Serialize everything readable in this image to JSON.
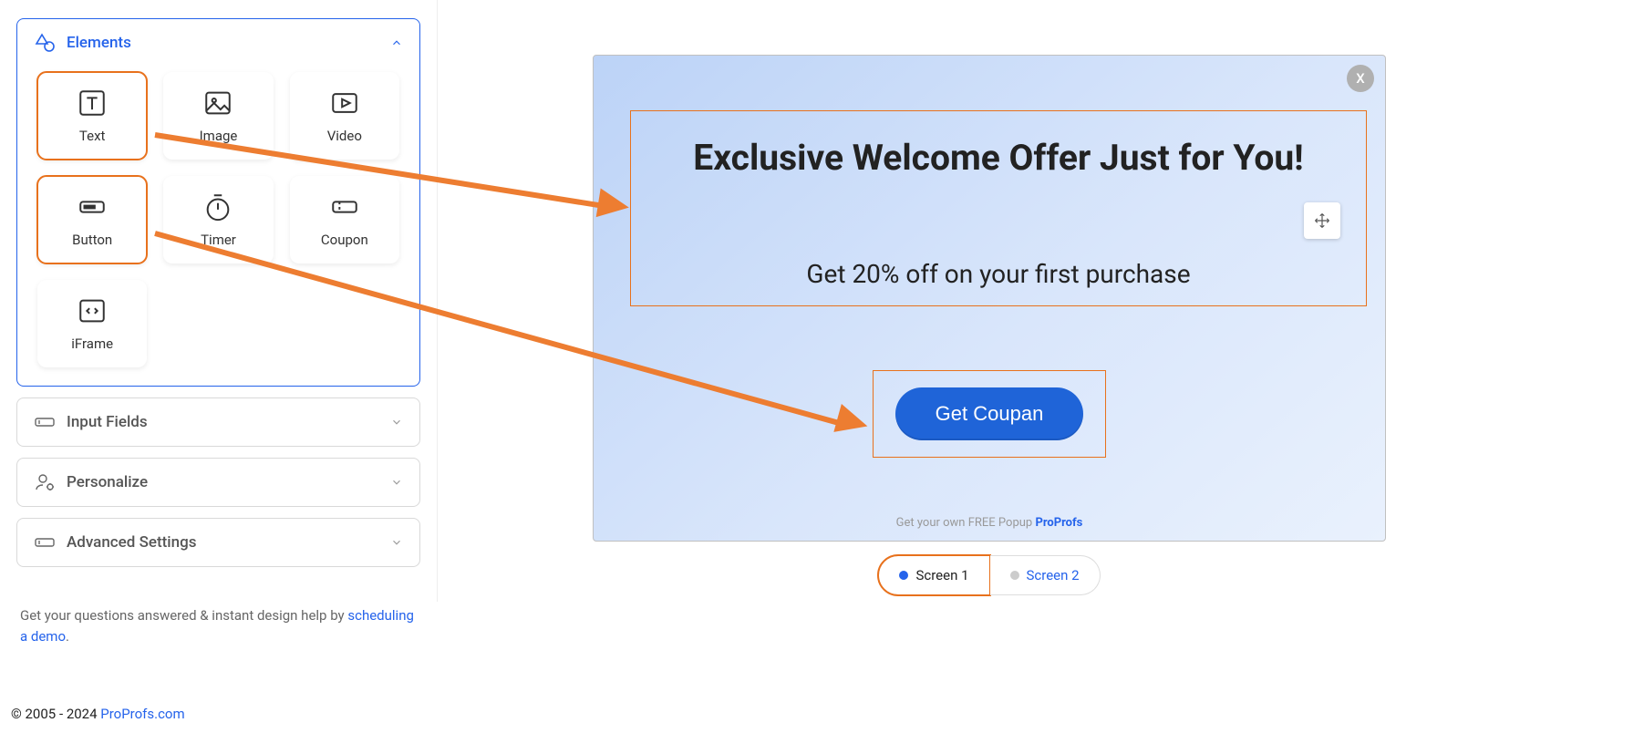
{
  "sidebar": {
    "sections": {
      "elements": {
        "title": "Elements"
      },
      "input_fields": {
        "title": "Input Fields"
      },
      "personalize": {
        "title": "Personalize"
      },
      "advanced": {
        "title": "Advanced Settings"
      }
    },
    "elements": [
      {
        "label": "Text"
      },
      {
        "label": "Image"
      },
      {
        "label": "Video"
      },
      {
        "label": "Button"
      },
      {
        "label": "Timer"
      },
      {
        "label": "Coupon"
      },
      {
        "label": "iFrame"
      }
    ],
    "help": {
      "prefix": "Get your questions answered & instant design help by ",
      "link_text": "scheduling a demo"
    }
  },
  "popup": {
    "headline": "Exclusive Welcome Offer Just for You!",
    "subhead": "Get 20% off on your first purchase",
    "button_label": "Get Coupan",
    "footer_prefix": "Get your own  ",
    "footer_mid": "FREE Popup",
    "footer_brand": "ProProfs",
    "close_label": "X"
  },
  "screens": {
    "s1": "Screen 1",
    "s2": "Screen 2"
  },
  "footer": {
    "copyright": "© 2005 - 2024 ",
    "link": "ProProfs.com"
  }
}
